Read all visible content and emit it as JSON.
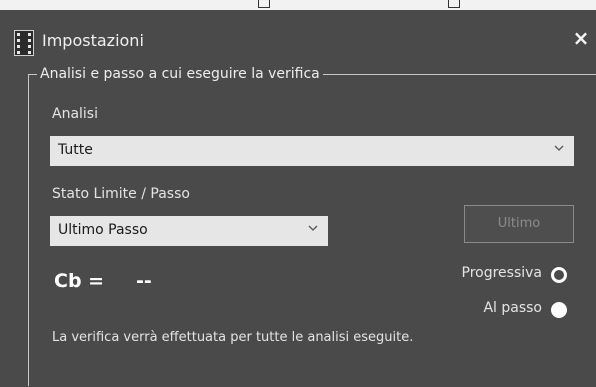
{
  "dialog": {
    "title": "Impostazioni",
    "close_glyph": "×"
  },
  "group": {
    "legend": "Analisi e passo a cui eseguire la verifica"
  },
  "analysis": {
    "label": "Analisi",
    "selected": "Tutte"
  },
  "limit_state": {
    "label": "Stato Limite / Passo",
    "selected": "Ultimo Passo"
  },
  "last_button": {
    "label": "Ultimo"
  },
  "cb": {
    "label": "Cb =",
    "value": "--"
  },
  "mode": {
    "progressive_label": "Progressiva",
    "step_label": "Al passo",
    "selected": "step"
  },
  "info_text": "La verifica verrà effettuata per tutte le analisi eseguite.",
  "icons": {
    "app": "app-icon",
    "close": "close-icon",
    "dropdown": "chevron-down-icon"
  },
  "colors": {
    "window_bg": "#4a4a4a",
    "select_bg": "#e6e6e6",
    "text": "#e4e4e4"
  }
}
